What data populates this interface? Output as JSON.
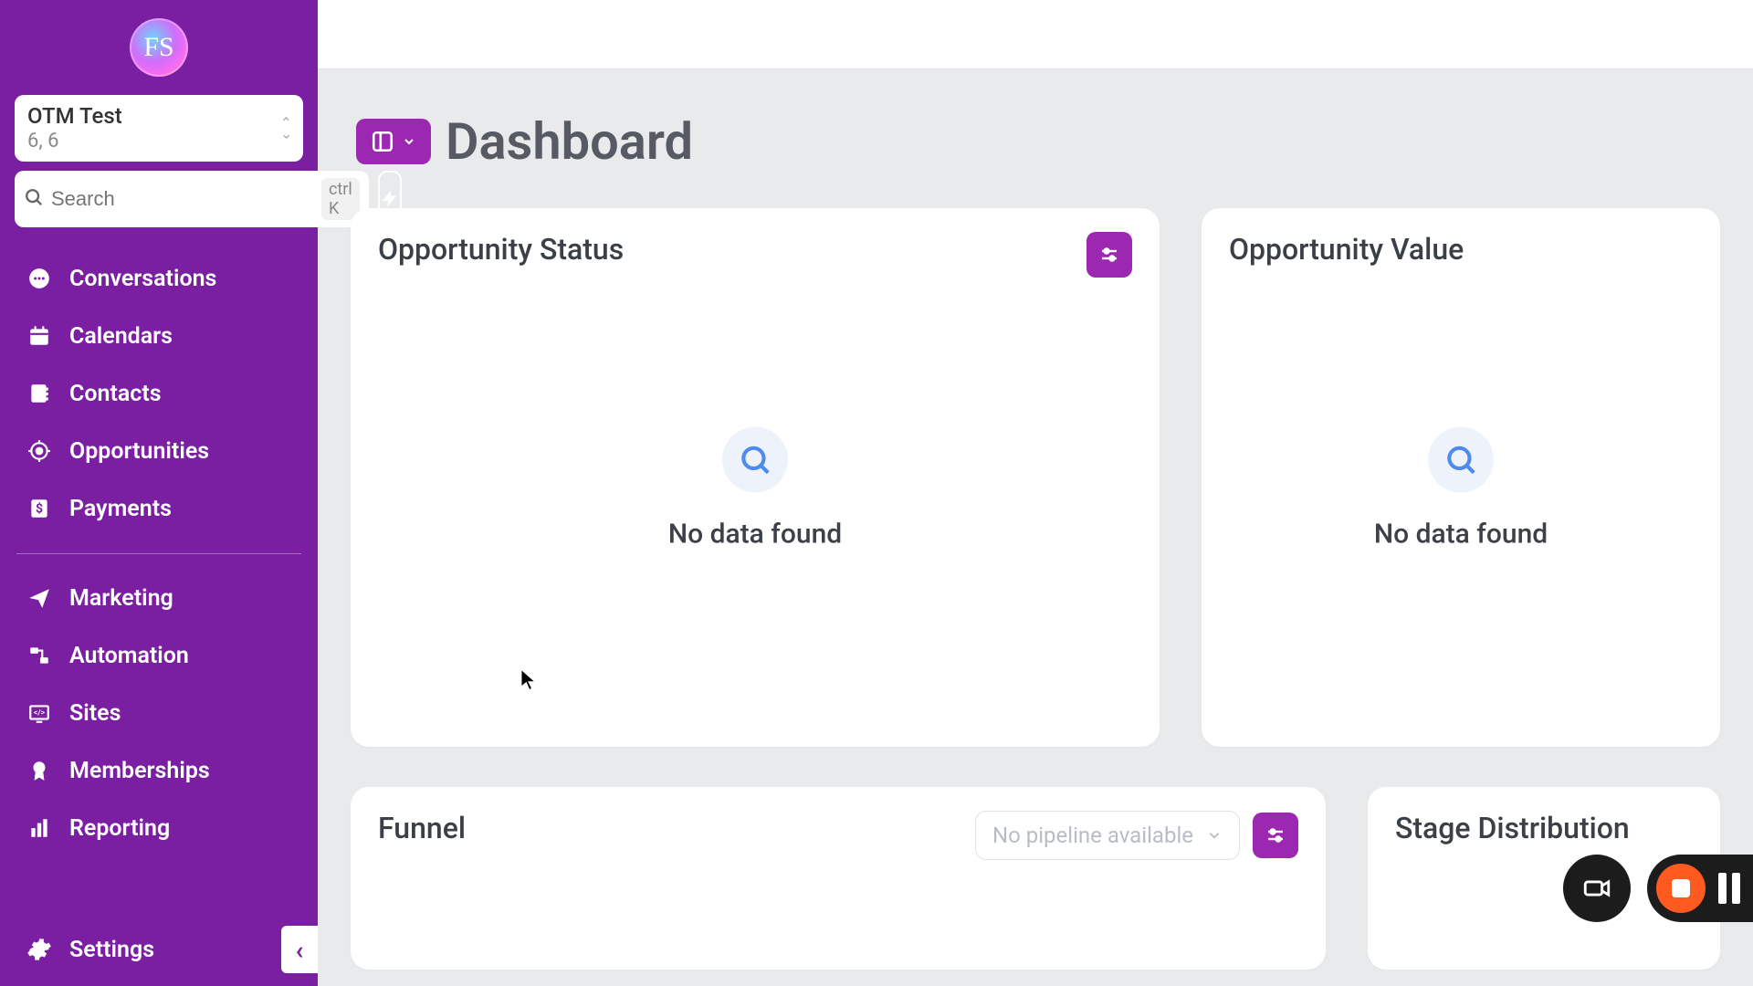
{
  "account": {
    "title": "OTM Test",
    "sub": "6, 6"
  },
  "search": {
    "placeholder": "Search",
    "shortcut": "ctrl K"
  },
  "nav": {
    "group1": [
      {
        "label": "Conversations"
      },
      {
        "label": "Calendars"
      },
      {
        "label": "Contacts"
      },
      {
        "label": "Opportunities"
      },
      {
        "label": "Payments"
      }
    ],
    "group2": [
      {
        "label": "Marketing"
      },
      {
        "label": "Automation"
      },
      {
        "label": "Sites"
      },
      {
        "label": "Memberships"
      },
      {
        "label": "Reporting"
      }
    ],
    "settings": "Settings"
  },
  "page": {
    "title": "Dashboard"
  },
  "cards": {
    "oppStatus": {
      "title": "Opportunity Status",
      "empty": "No data found"
    },
    "oppValue": {
      "title": "Opportunity Value",
      "empty": "No data found"
    },
    "funnel": {
      "title": "Funnel",
      "pipelinePlaceholder": "No pipeline available"
    },
    "stageDist": {
      "title": "Stage Distribution"
    }
  }
}
